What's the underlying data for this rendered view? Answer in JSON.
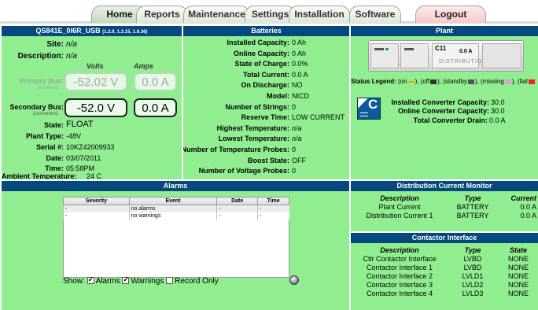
{
  "tabs": [
    {
      "label": "Home"
    },
    {
      "label": "Reports"
    },
    {
      "label": "Maintenance"
    },
    {
      "label": "Settings"
    },
    {
      "label": "Installation"
    },
    {
      "label": "Software"
    },
    {
      "label": "Logout"
    }
  ],
  "system": {
    "title": "QS841E_0I6R_USB",
    "version": "(1.2.0, 1.3.15, 1.6.36)",
    "site_label": "Site:",
    "site": "n/a",
    "description_label": "Description:",
    "description": "n/a",
    "volts_header": "Volts",
    "amps_header": "Amps",
    "primary_label": "Primary Bus:",
    "primary_sub": "(rectifiers)",
    "primary_volts": "-52.02 V",
    "primary_amps": "0.0 A",
    "secondary_label": "Secondary Bus:",
    "secondary_sub": "(converters)",
    "secondary_volts": "-52.0 V",
    "secondary_amps": "0.0 A",
    "state_label": "State:",
    "state": "FLOAT",
    "plant_type_label": "Plant Type:",
    "plant_type": "-48V",
    "serial_label": "Serial #:",
    "serial": "10KZ42009933",
    "date_label": "Date:",
    "date": "03/07/2011",
    "time_label": "Time:",
    "time": "05:58PM",
    "ambient_label": "Ambient Temperature:",
    "ambient": "24 C"
  },
  "batteries": {
    "title": "Batteries",
    "rows": [
      {
        "label": "Installed Capacity:",
        "value": "0 Ah"
      },
      {
        "label": "Online Capacity:",
        "value": "0 Ah"
      },
      {
        "label": "State of Charge:",
        "value": "0.0%"
      },
      {
        "label": "Total Current:",
        "value": "0.0 A"
      },
      {
        "label": "On Discharge:",
        "value": "NO"
      },
      {
        "label": "Model:",
        "value": "NICD"
      },
      {
        "label": "Number of Strings:",
        "value": "0"
      },
      {
        "label": "Reserve Time:",
        "value": "LOW CURRENT"
      },
      {
        "label": "Highest Temperature:",
        "value": "n/a"
      },
      {
        "label": "Lowest Temperature:",
        "value": "n/a"
      },
      {
        "label": "Number of Temperature Probes:",
        "value": "0"
      },
      {
        "label": "Boost State:",
        "value": "OFF"
      },
      {
        "label": "Number of Voltage Probes:",
        "value": "0"
      }
    ]
  },
  "plant": {
    "title": "Plant",
    "shelf_code": "C11",
    "shelf_value": "0.0 A",
    "shelf_text": "DISTRIBUTION",
    "legend_label": "Status Legend:",
    "legend_on": "(on",
    "legend_off": "), (off",
    "legend_standby": "), (standby",
    "legend_missing": "), (missing",
    "legend_fail": "), (fail",
    "converter_icon_letter": "C",
    "installed_conv_label": "Installed Converter Capacity:",
    "installed_conv": "30.0",
    "online_conv_label": "Online Converter Capacity:",
    "online_conv": "30.0",
    "total_drain_label": "Total Converter Drain:",
    "total_drain": "0.0 A"
  },
  "alarms": {
    "title": "Alarms",
    "columns": [
      "Severity",
      "Event",
      "Date",
      "Time"
    ],
    "rows": [
      {
        "severity": "-",
        "event": "no alarms",
        "date": "-",
        "time": "-"
      },
      {
        "severity": "-",
        "event": "no warnings",
        "date": "-",
        "time": "-"
      }
    ],
    "show_label": "Show:",
    "alarms_cb": "Alarms",
    "warnings_cb": "Warnings",
    "record_cb": "Record Only"
  },
  "distribution": {
    "title": "Distribution Current Monitor",
    "columns": [
      "Description",
      "Type",
      "Current"
    ],
    "rows": [
      {
        "description": "Plant Current",
        "type": "BATTERY",
        "current": "0.0 A"
      },
      {
        "description": "Distribution Current 1",
        "type": "BATTERY",
        "current": "0.0 A"
      }
    ]
  },
  "contactor": {
    "title": "Contactor Interface",
    "columns": [
      "Description",
      "Type",
      "State"
    ],
    "rows": [
      {
        "description": "Ctlr Contactor Interface",
        "type": "LVBD",
        "state": "NONE"
      },
      {
        "description": "Contactor Interface 1",
        "type": "LVBD",
        "state": "NONE"
      },
      {
        "description": "Contactor Interface 2",
        "type": "LVLD1",
        "state": "NONE"
      },
      {
        "description": "Contactor Interface 3",
        "type": "LVLD2",
        "state": "NONE"
      },
      {
        "description": "Contactor Interface 4",
        "type": "LVLD3",
        "state": "NONE"
      }
    ]
  },
  "colors": {
    "panel_bg": "#90ee90",
    "header_bg": "#05487e",
    "header_text": "#ffffff"
  }
}
